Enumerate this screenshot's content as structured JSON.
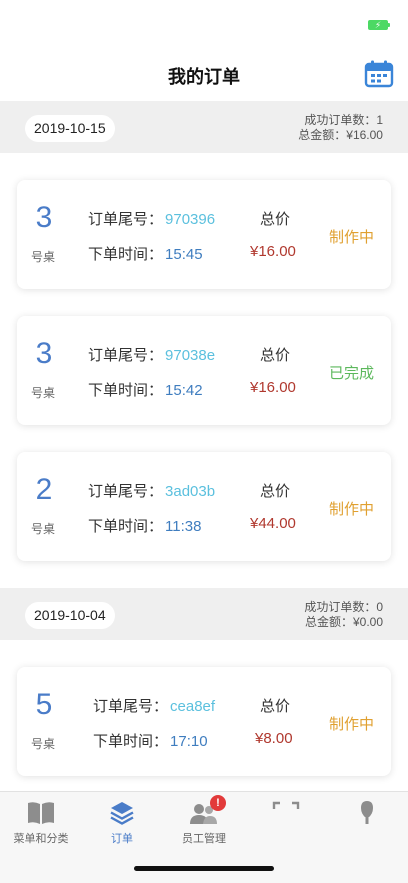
{
  "status_bar": {
    "battery_glyph": "⚡"
  },
  "header": {
    "title": "我的订单",
    "calendar_icon": "calendar-icon"
  },
  "groups": [
    {
      "date": "2019-10-15",
      "summary_count": "成功订单数：1",
      "summary_amount": "总金额：¥16.00",
      "orders": [
        {
          "table": "3",
          "table_label": "号桌",
          "order_label": "订单尾号：",
          "order_no": "970396",
          "time_label": "下单时间：",
          "time": "15:45",
          "total_label": "总价",
          "price": "¥16.00",
          "status": "制作中",
          "status_type": "making"
        },
        {
          "table": "3",
          "table_label": "号桌",
          "order_label": "订单尾号：",
          "order_no": "97038e",
          "time_label": "下单时间：",
          "time": "15:42",
          "total_label": "总价",
          "price": "¥16.00",
          "status": "已完成",
          "status_type": "done"
        },
        {
          "table": "2",
          "table_label": "号桌",
          "order_label": "订单尾号：",
          "order_no": "3ad03b",
          "time_label": "下单时间：",
          "time": "11:38",
          "total_label": "总价",
          "price": "¥44.00",
          "status": "制作中",
          "status_type": "making"
        }
      ]
    },
    {
      "date": "2019-10-04",
      "summary_count": "成功订单数：0",
      "summary_amount": "总金额：¥0.00",
      "orders": [
        {
          "table": "5",
          "table_label": "号桌",
          "order_label": "订单尾号：",
          "order_no": "cea8ef",
          "time_label": "下单时间：",
          "time": "17:10",
          "total_label": "总价",
          "price": "¥8.00",
          "status": "制作中",
          "status_type": "making"
        }
      ]
    }
  ],
  "tabbar": {
    "tabs": [
      {
        "label": "菜单和分类",
        "icon": "book-icon",
        "active": false
      },
      {
        "label": "订单",
        "icon": "layers-icon",
        "active": true
      },
      {
        "label": "员工管理",
        "icon": "users-icon",
        "active": false,
        "badge": "!"
      },
      {
        "label": "",
        "icon": "scan-icon",
        "active": false
      },
      {
        "label": "",
        "icon": "profile-icon",
        "active": false
      }
    ]
  },
  "colors": {
    "accent": "#4a7cc8",
    "making": "#e0a030",
    "done": "#5cb85c",
    "price": "#b0382e",
    "order_no": "#5bc0de"
  }
}
